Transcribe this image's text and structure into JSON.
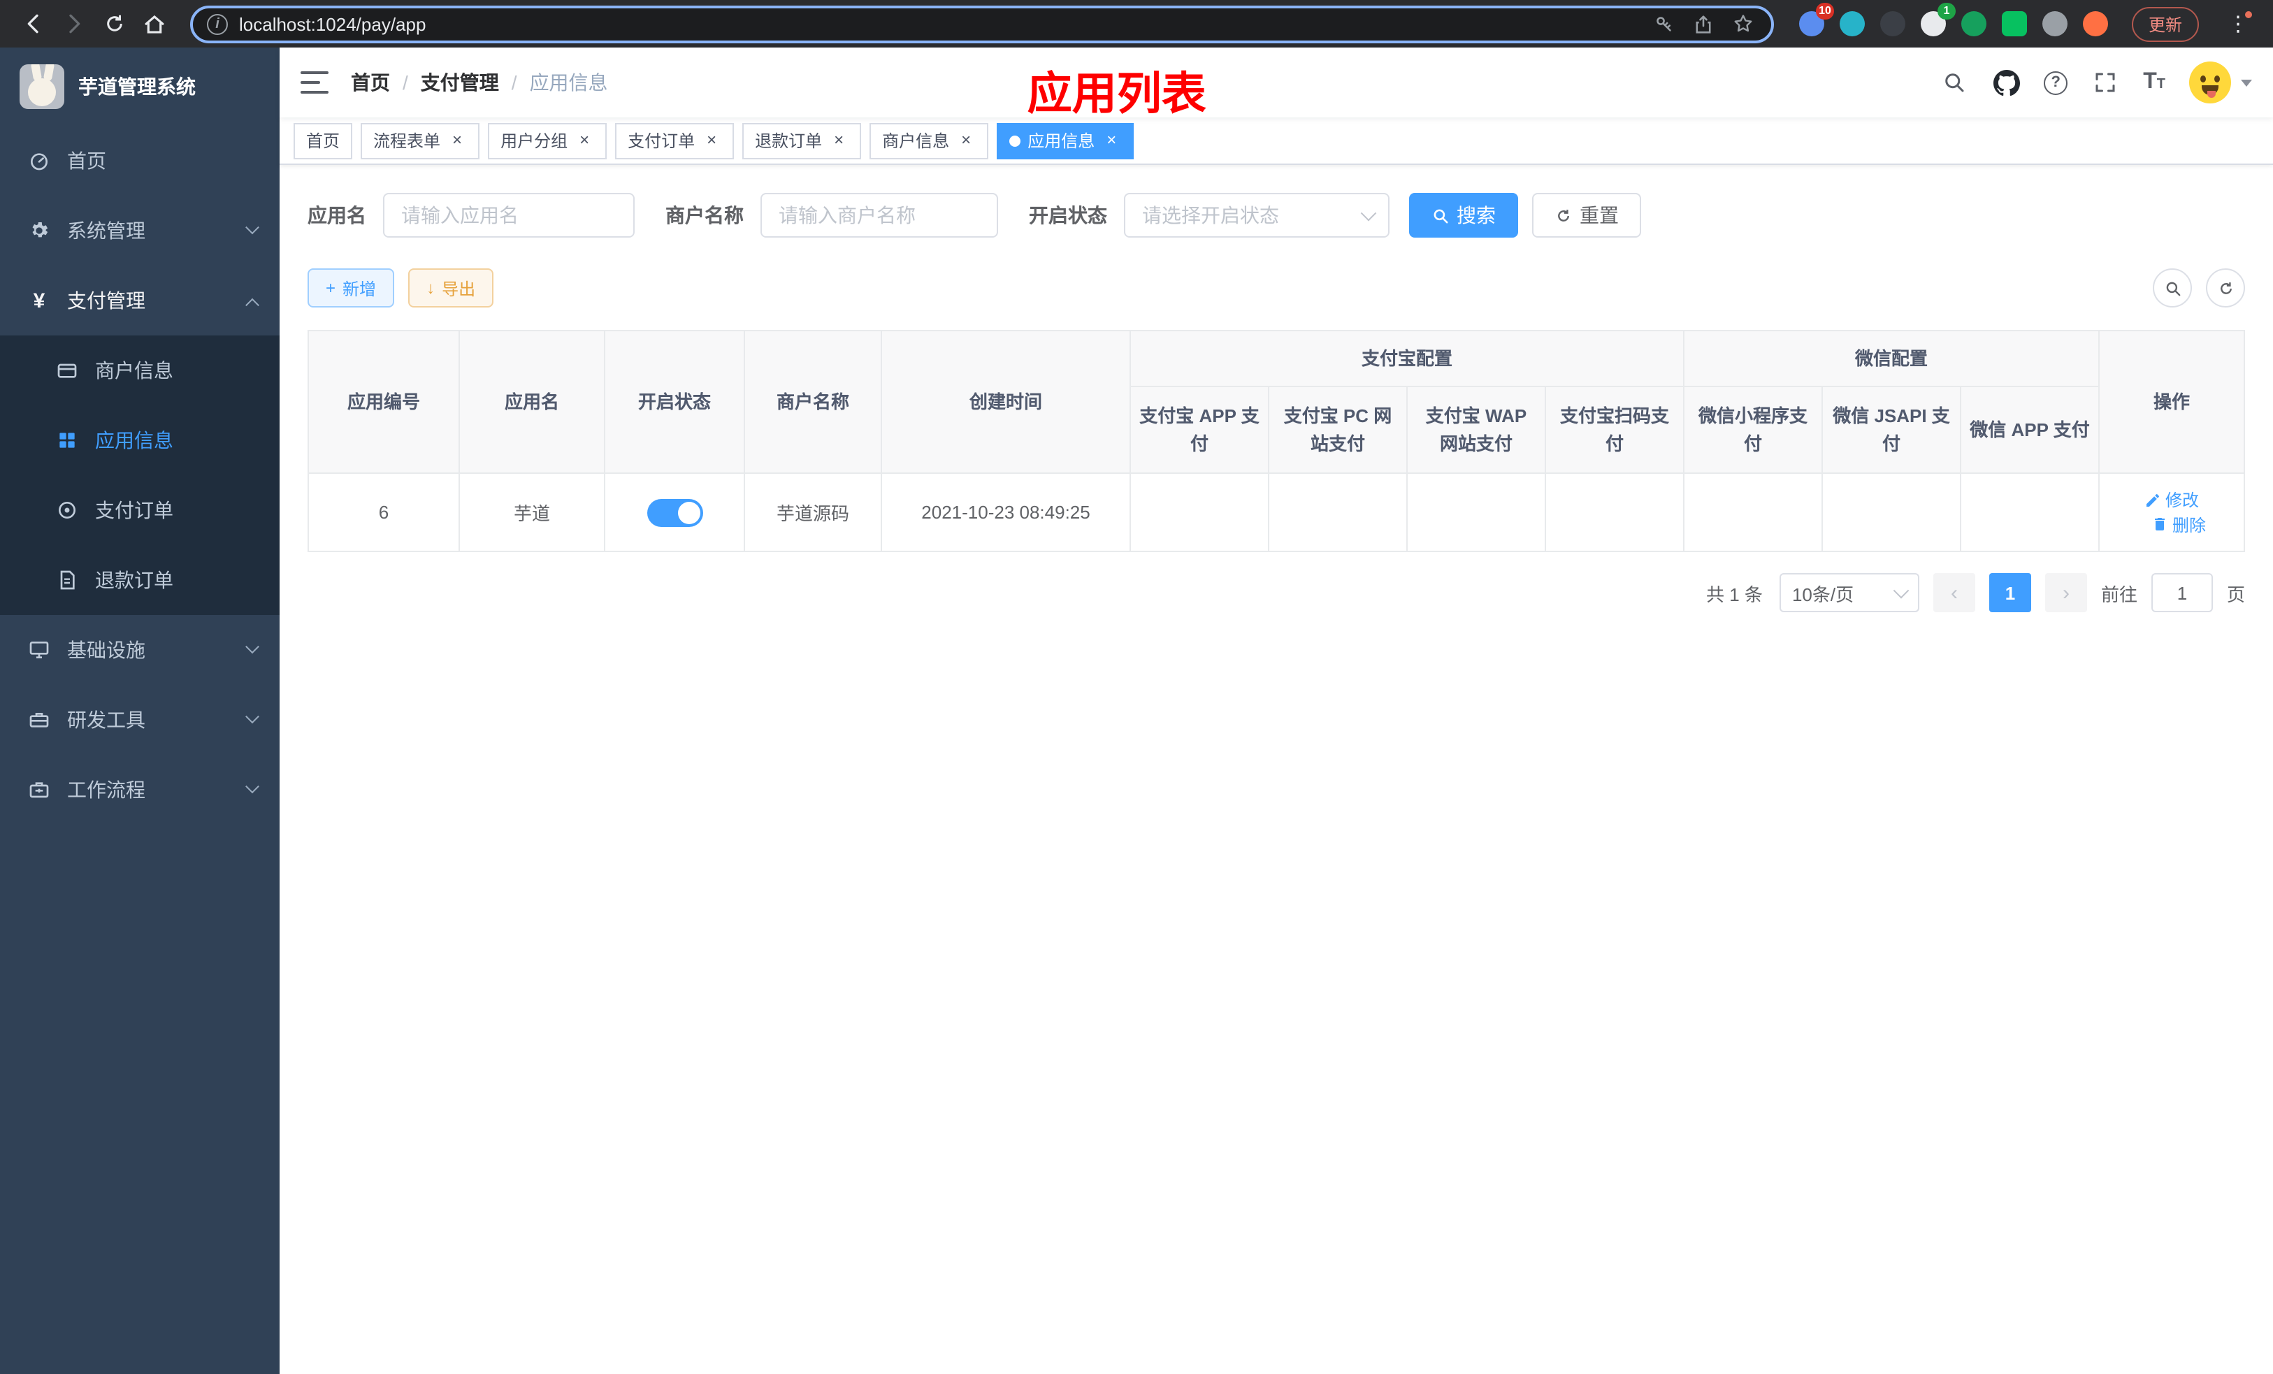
{
  "browser": {
    "url": "localhost:1024/pay/app",
    "update_label": "更新",
    "ext_badge_red": "10",
    "ext_badge_green": "1"
  },
  "icons": {
    "info": "i",
    "help": "?",
    "yen": "¥",
    "font_big": "T",
    "font_small": "T",
    "plus": "+",
    "close": "×",
    "download": "↓",
    "more": "⋮",
    "prev": "‹",
    "next": "›"
  },
  "sidebar": {
    "title": "芋道管理系统",
    "menu": {
      "home": "首页",
      "system": "系统管理",
      "payment": "支付管理",
      "infra": "基础设施",
      "devtools": "研发工具",
      "workflow": "工作流程"
    },
    "payment_children": {
      "merchant": "商户信息",
      "app": "应用信息",
      "pay_order": "支付订单",
      "refund_order": "退款订单"
    }
  },
  "navbar": {
    "breadcrumb": {
      "home": "首页",
      "section": "支付管理",
      "current": "应用信息",
      "separator": "/"
    },
    "annotation": "应用列表"
  },
  "tabs": {
    "home": "首页",
    "flow_form": "流程表单",
    "user_group": "用户分组",
    "pay_order": "支付订单",
    "refund_order": "退款订单",
    "merchant_info": "商户信息",
    "app_info": "应用信息"
  },
  "filters": {
    "app_name_label": "应用名",
    "app_name_placeholder": "请输入应用名",
    "merchant_label": "商户名称",
    "merchant_placeholder": "请输入商户名称",
    "status_label": "开启状态",
    "status_placeholder": "请选择开启状态",
    "search_label": "搜索",
    "reset_label": "重置"
  },
  "toolbar": {
    "add_label": "新增",
    "export_label": "导出"
  },
  "table": {
    "headers": {
      "app_id": "应用编号",
      "app_name": "应用名",
      "status": "开启状态",
      "merchant": "商户名称",
      "create_time": "创建时间",
      "alipay_group": "支付宝配置",
      "wechat_group": "微信配置",
      "alipay_app": "支付宝 APP 支付",
      "alipay_pc": "支付宝 PC 网站支付",
      "alipay_wap": "支付宝 WAP 网站支付",
      "alipay_qr": "支付宝扫码支付",
      "wechat_lite": "微信小程序支付",
      "wechat_jsapi": "微信 JSAPI 支付",
      "wechat_app": "微信 APP 支付",
      "actions": "操作"
    },
    "row": {
      "app_id": "6",
      "app_name": "芋道",
      "status_enabled": true,
      "merchant": "芋道源码",
      "create_time": "2021-10-23 08:49:25",
      "pay_channels": [
        false,
        false,
        false,
        false,
        false,
        true,
        false
      ],
      "edit_label": "修改",
      "delete_label": "删除"
    }
  },
  "pagination": {
    "total": "共 1 条",
    "page_size": "10条/页",
    "current_page": "1",
    "goto_label": "前往",
    "goto_value": "1",
    "page_unit": "页"
  },
  "colors": {
    "primary": "#409eff",
    "success": "#13ce66",
    "danger": "#f56c6c",
    "warning": "#e6a23c",
    "annotation_red": "#fe0000",
    "sidebar_bg": "#304156",
    "submenu_bg": "#1f2d3d"
  }
}
